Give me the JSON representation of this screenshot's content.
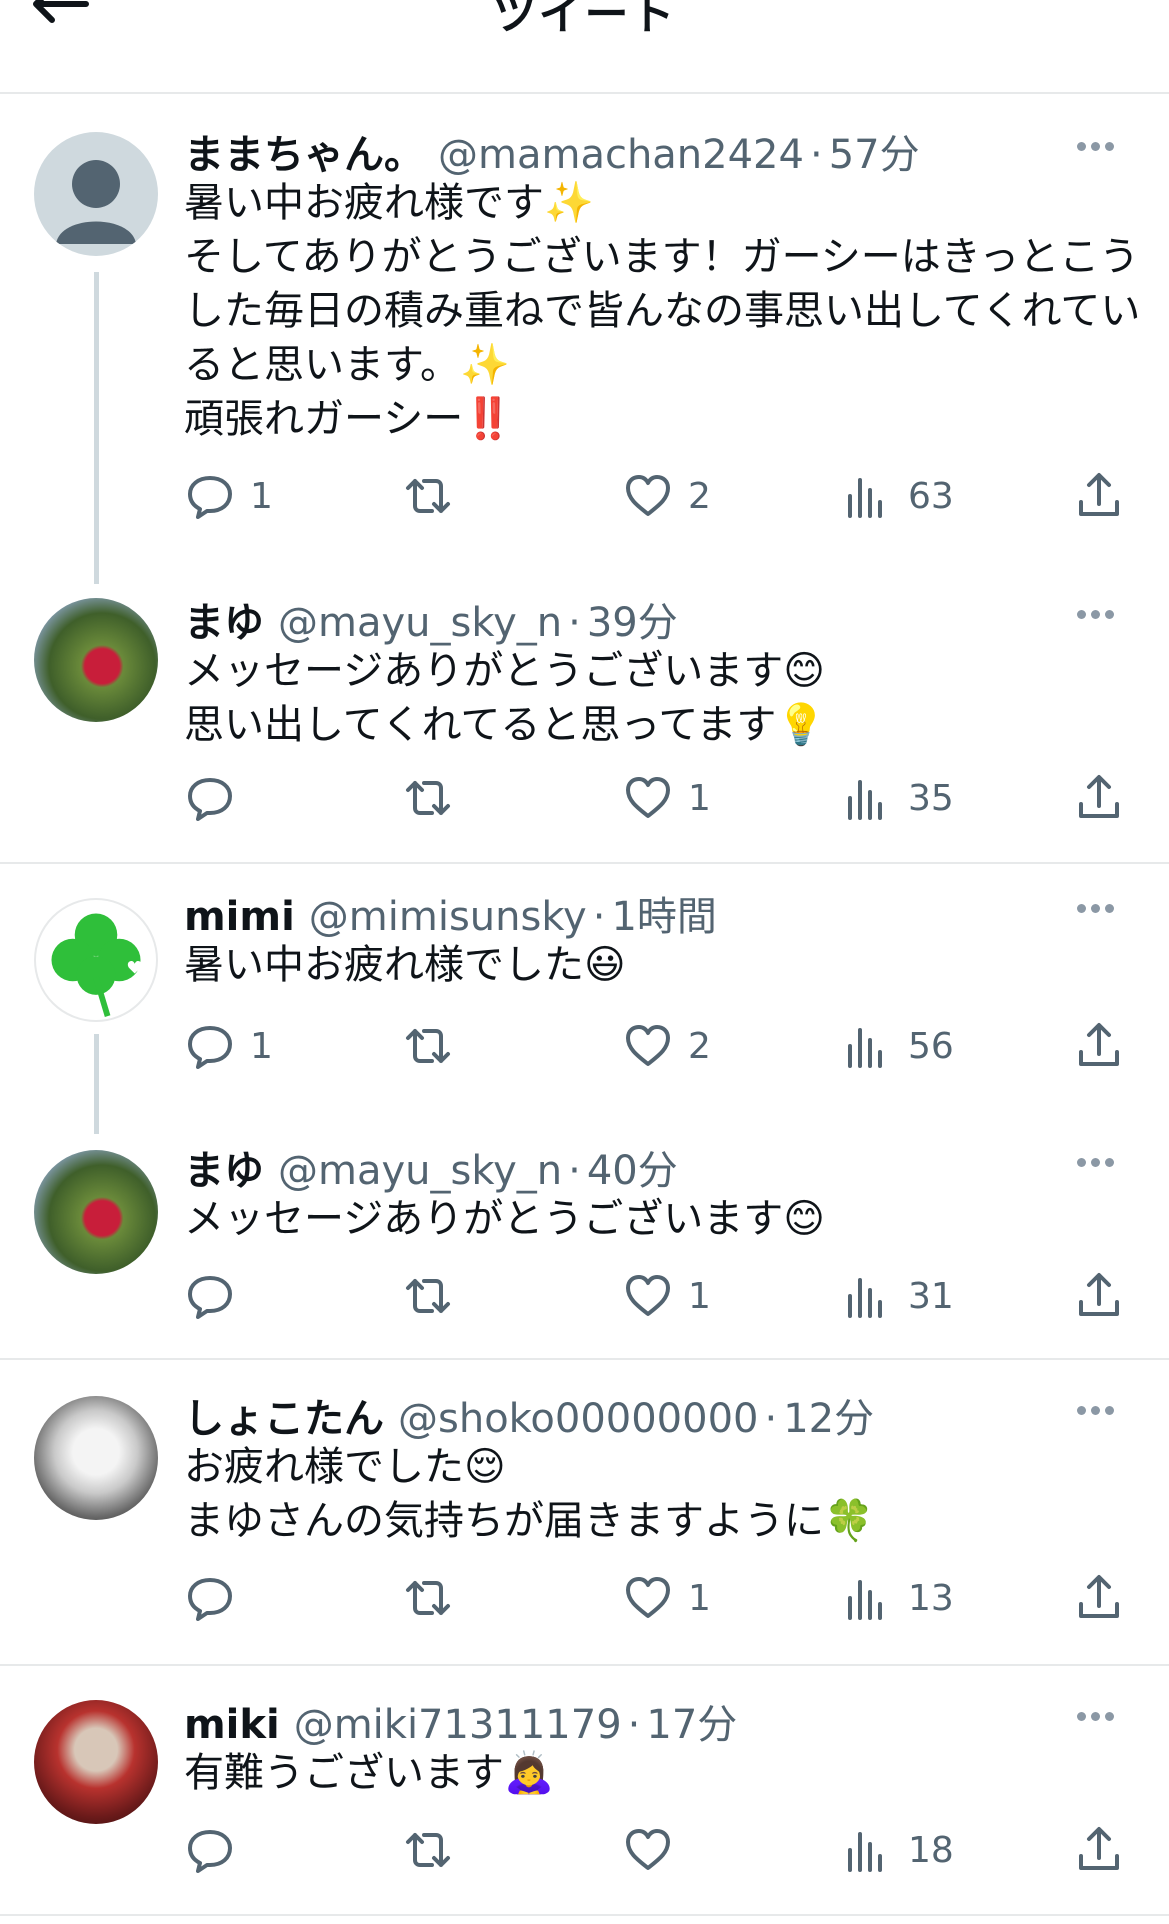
{
  "header": {
    "title": "ツイート",
    "back_icon": "arrow-left-icon"
  },
  "tweets": [
    {
      "name": "ままちゃん。",
      "handle": "@mamachan2424",
      "sep": "·",
      "time": "57分",
      "lines": [
        "暑い中お疲れ様です✨",
        "そしてありがとうございます！ガーシーはきっとこう",
        "した毎日の積み重ねで皆んなの事思い出してくれてい",
        "ると思います。✨",
        "頑張れガーシー‼️"
      ],
      "replies": "1",
      "retweets": "",
      "likes": "2",
      "views": "63"
    },
    {
      "name": "まゆ",
      "handle": "@mayu_sky_n",
      "sep": "·",
      "time": "39分",
      "lines": [
        "メッセージありがとうございます😊",
        "思い出してくれてると思ってます💡"
      ],
      "replies": "",
      "retweets": "",
      "likes": "1",
      "views": "35"
    },
    {
      "name": "mimi",
      "handle": "@mimisunsky",
      "sep": "·",
      "time": "1時間",
      "lines": [
        "暑い中お疲れ様でした😃"
      ],
      "replies": "1",
      "retweets": "",
      "likes": "2",
      "views": "56"
    },
    {
      "name": "まゆ",
      "handle": "@mayu_sky_n",
      "sep": "·",
      "time": "40分",
      "lines": [
        "メッセージありがとうございます😊"
      ],
      "replies": "",
      "retweets": "",
      "likes": "1",
      "views": "31"
    },
    {
      "name": "しょこたん",
      "handle": "@shoko00000000",
      "sep": "·",
      "time": "12分",
      "lines": [
        "お疲れ様でした😌",
        "まゆさんの気持ちが届きますように🍀"
      ],
      "replies": "",
      "retweets": "",
      "likes": "1",
      "views": "13"
    },
    {
      "name": "miki",
      "handle": "@miki71311179",
      "sep": "·",
      "time": "17分",
      "lines": [
        "有難うございます🙇‍♀️"
      ],
      "replies": "",
      "retweets": "",
      "likes": "",
      "views": "18"
    }
  ],
  "icons": [
    "reply-icon",
    "retweet-icon",
    "like-icon",
    "views-icon",
    "share-icon",
    "more-icon"
  ],
  "colors": {
    "text": "#0f1419",
    "secondary": "#536471",
    "divider": "#e7e9ea",
    "thread": "#cfd9de"
  }
}
